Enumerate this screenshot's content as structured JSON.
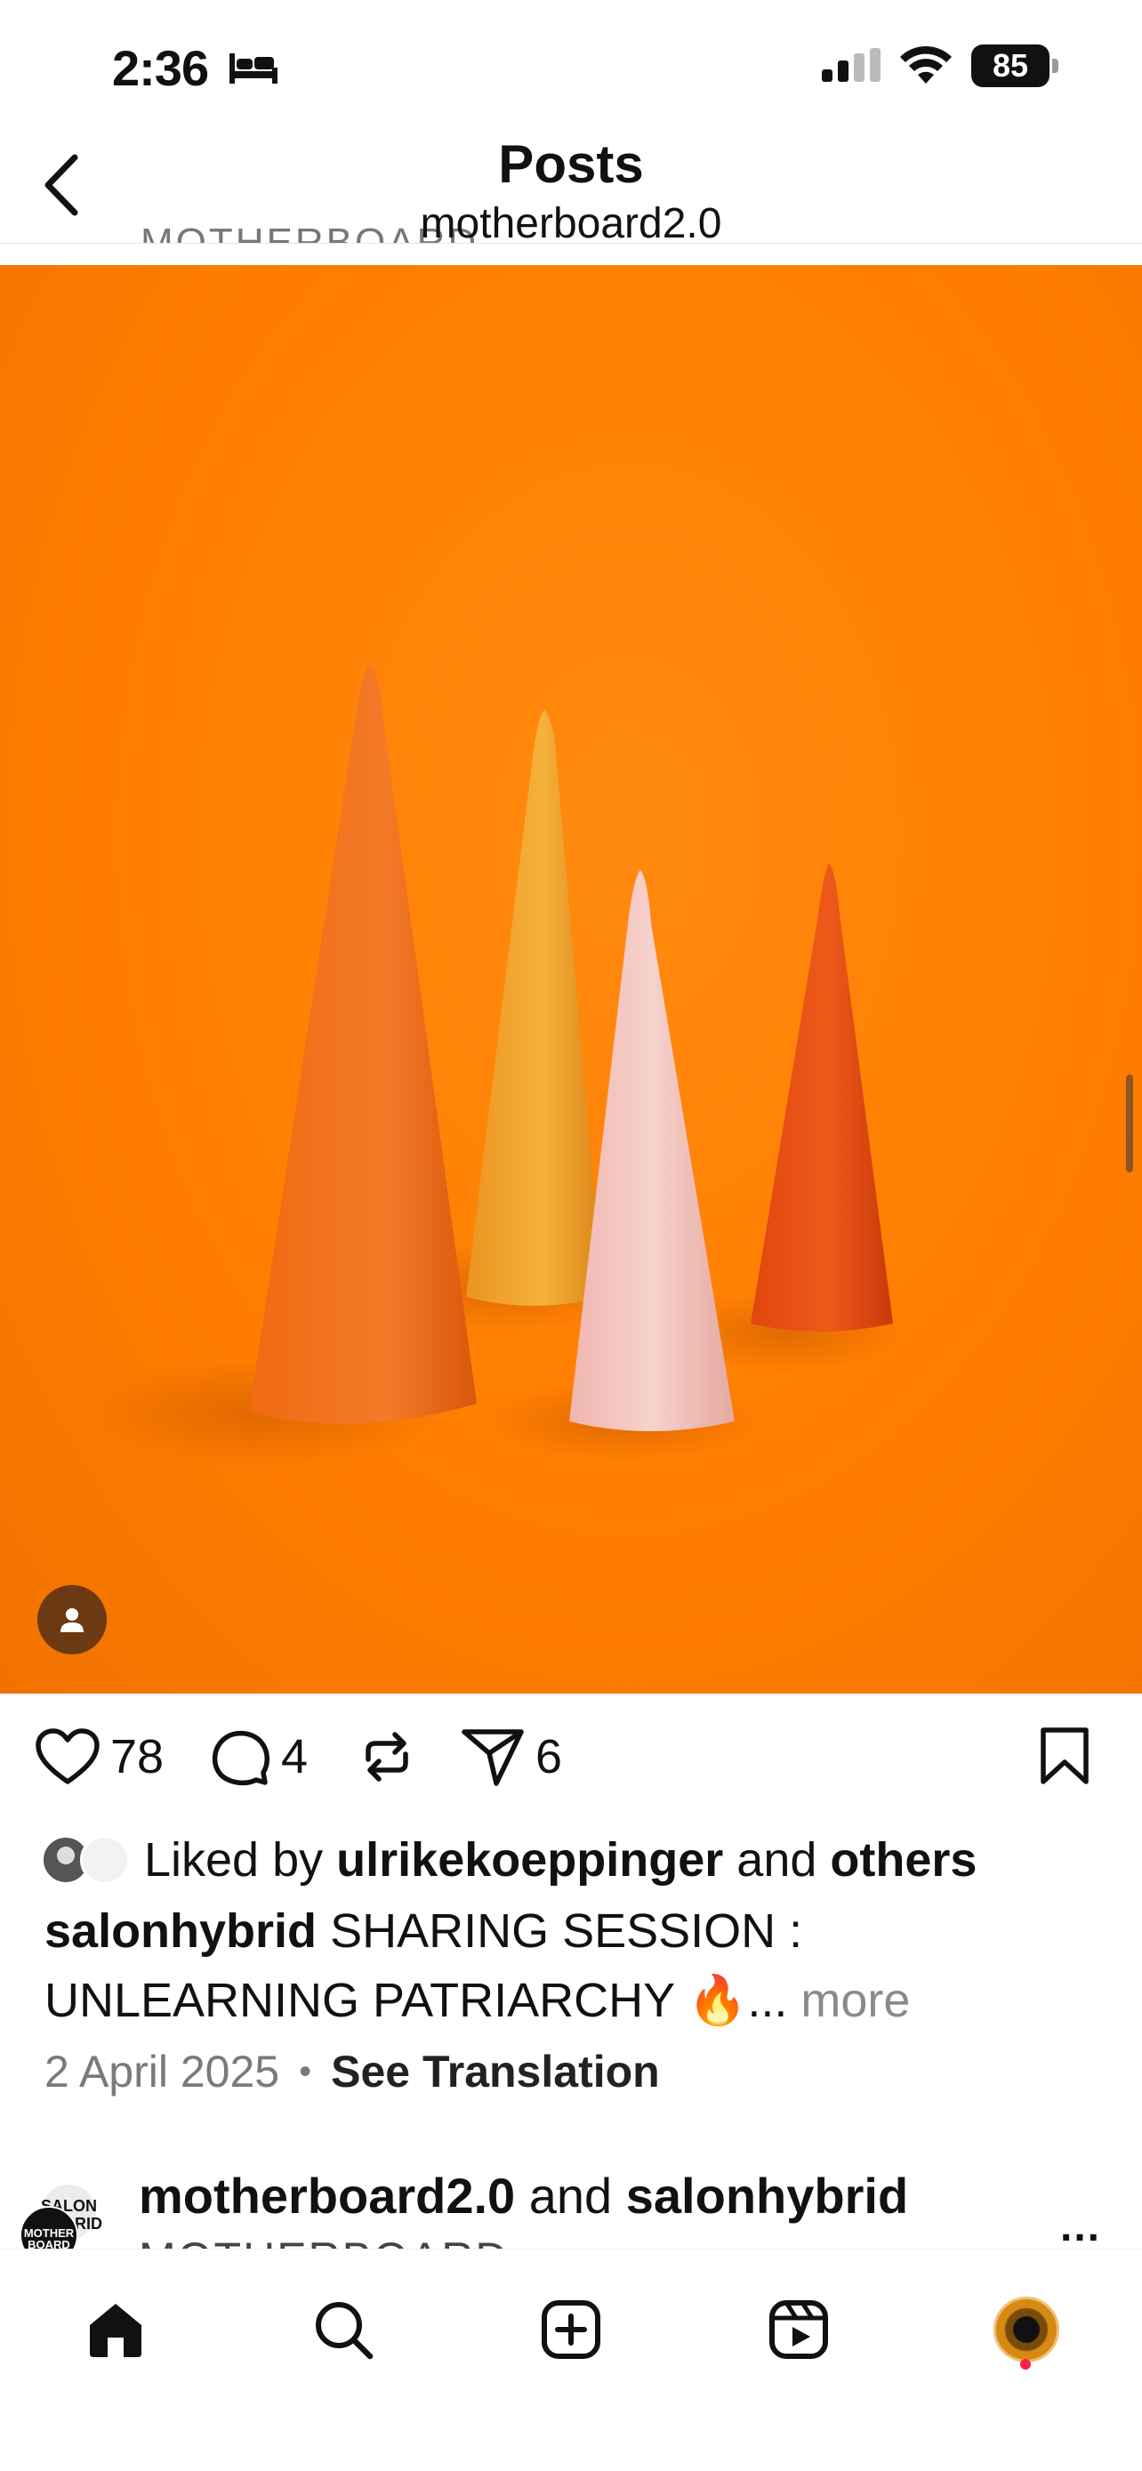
{
  "status_bar": {
    "time": "2:36",
    "battery": "85",
    "icons": [
      "bed-icon",
      "signal-icon",
      "wifi-icon",
      "battery-icon"
    ]
  },
  "header": {
    "title": "Posts",
    "subtitle": "motherboard2.0",
    "peek_text": "MOTHERBOARD",
    "back_icon": "chevron-left-icon"
  },
  "post": {
    "image_icon": "user-tag-icon",
    "likes_count": "78",
    "comments_count": "4",
    "shares_count": "6",
    "liked_by_prefix": "Liked by",
    "liked_by_user": "ulrikekoeppinger",
    "liked_by_and": "and",
    "liked_by_others": "others",
    "caption_user": "salonhybrid",
    "caption_text": "SHARING SESSION : UNLEARNING PATRIARCHY 🔥...",
    "more_label": "more",
    "date": "2 April 2025",
    "translate_label": "See Translation"
  },
  "next_post": {
    "author1": "motherboard2.0",
    "and": "and",
    "author2": "salonhybrid",
    "subtitle": "MOTHERBOARD",
    "more_options": "...",
    "avatar_back_text": "SALON HYBRID",
    "avatar_front_text": "MOTHER BOARD"
  },
  "bottom_nav": {
    "items": [
      "home-icon",
      "search-icon",
      "create-icon",
      "reels-icon",
      "profile-avatar"
    ]
  },
  "colors": {
    "background_orange": "#ff7e00",
    "notification_dot": "#ff1f4b"
  }
}
